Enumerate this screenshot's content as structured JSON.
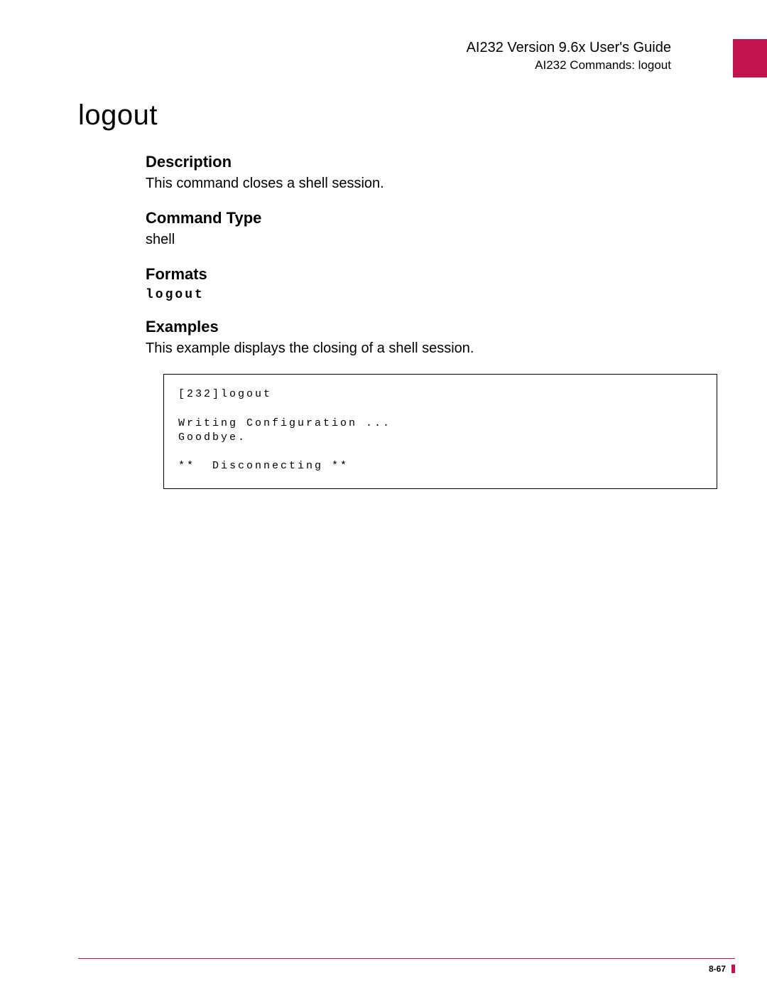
{
  "header": {
    "doc_title": "AI232 Version 9.6x User's Guide",
    "doc_subtitle": "AI232 Commands: logout"
  },
  "command_title": "logout",
  "sections": {
    "description": {
      "heading": "Description",
      "body": "This command closes a shell session."
    },
    "command_type": {
      "heading": "Command Type",
      "body": "shell"
    },
    "formats": {
      "heading": "Formats",
      "command": "logout"
    },
    "examples": {
      "heading": "Examples",
      "body": "This example displays the closing of a shell session.",
      "output": "[232]logout\n\nWriting Configuration ...\nGoodbye.\n\n**  Disconnecting **"
    }
  },
  "footer": {
    "page_number": "8-67"
  }
}
